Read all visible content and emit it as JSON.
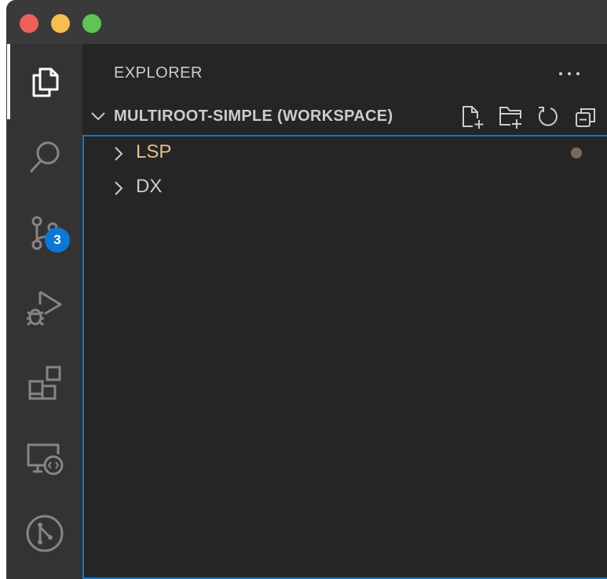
{
  "window": {
    "traffic_lights": [
      {
        "name": "close",
        "color": "#ed5f57"
      },
      {
        "name": "minimize",
        "color": "#f5be4f"
      },
      {
        "name": "zoom",
        "color": "#5fc454"
      }
    ]
  },
  "activity_bar": {
    "items": [
      {
        "name": "explorer",
        "icon": "files-icon",
        "active": true
      },
      {
        "name": "search",
        "icon": "search-icon"
      },
      {
        "name": "source-control",
        "icon": "source-control-icon",
        "badge": "3"
      },
      {
        "name": "run-debug",
        "icon": "run-debug-icon"
      },
      {
        "name": "extensions",
        "icon": "extensions-icon"
      },
      {
        "name": "remote-explorer",
        "icon": "remote-explorer-icon"
      },
      {
        "name": "git-graph",
        "icon": "git-graph-icon"
      }
    ]
  },
  "sidebar": {
    "title": "EXPLORER",
    "more_actions": "···",
    "workspace": {
      "title": "MULTIROOT-SIMPLE (WORKSPACE)",
      "actions": [
        "new-file-icon",
        "new-folder-icon",
        "refresh-icon",
        "collapse-all-icon"
      ]
    },
    "folders": [
      {
        "label": "LSP",
        "color": "#e2c08d",
        "modified": true
      },
      {
        "label": "DX",
        "color": "#cccccc",
        "modified": false
      }
    ]
  },
  "colors": {
    "accent": "#0a78d4",
    "icon": "#858585",
    "icon_active": "#ffffff",
    "text": "#cccccc"
  }
}
